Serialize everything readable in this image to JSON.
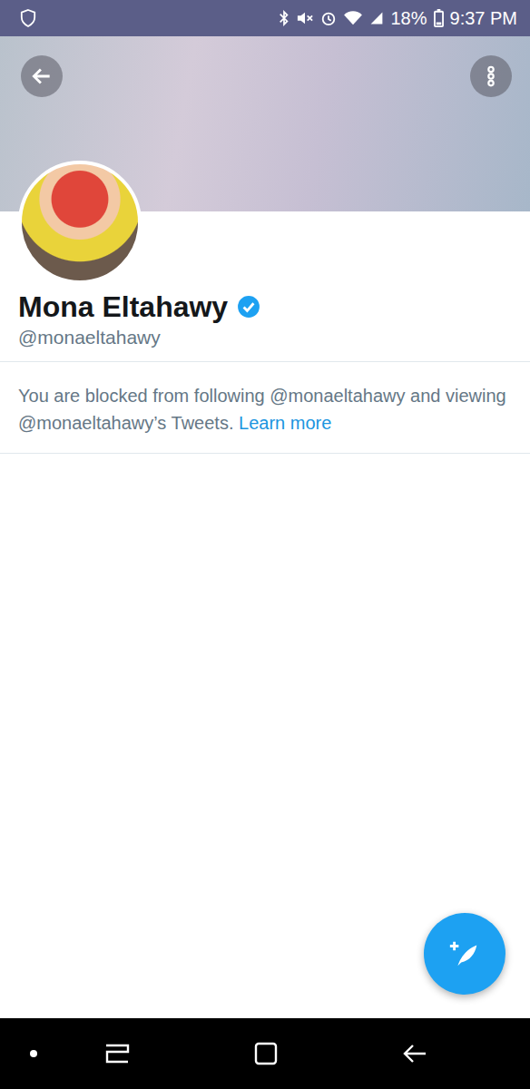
{
  "status_bar": {
    "battery": "18%",
    "time": "9:37 PM"
  },
  "profile": {
    "name": "Mona Eltahawy",
    "handle": "@monaeltahawy",
    "verified": true
  },
  "blocked_notice": {
    "text": "You are blocked from following @monaeltahawy and viewing @monaeltahawy’s Tweets.",
    "link": "Learn more"
  }
}
